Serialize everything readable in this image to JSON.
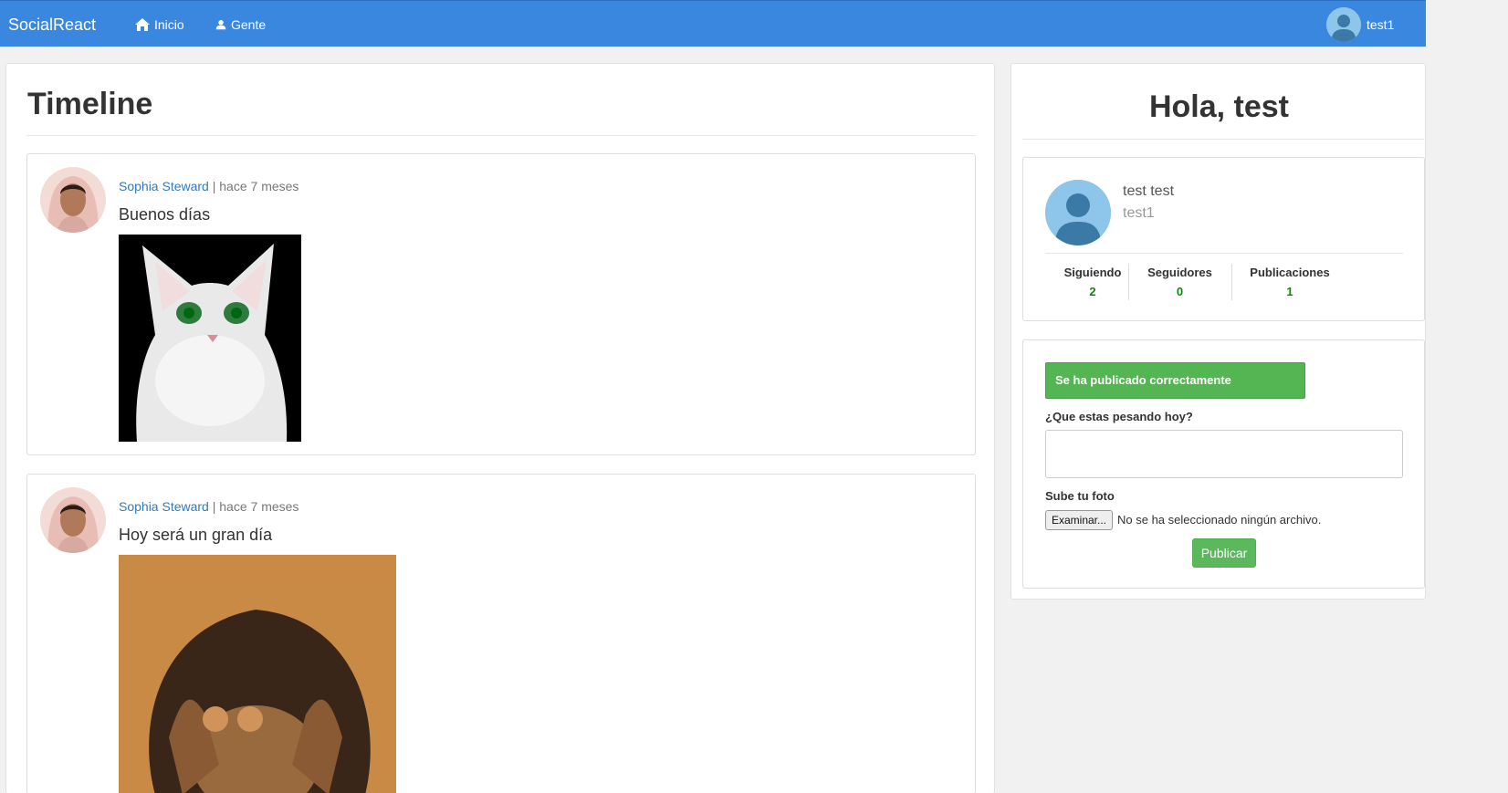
{
  "navbar": {
    "brand": "SocialReact",
    "home_label": "Inicio",
    "people_label": "Gente",
    "username": "test1",
    "home_icon": "home-icon",
    "people_icon": "user-icon"
  },
  "timeline": {
    "title": "Timeline",
    "posts": [
      {
        "author": "Sophia Steward",
        "separator": " | ",
        "time": "hace 7 meses",
        "text": "Buenos días"
      },
      {
        "author": "Sophia Steward",
        "separator": " | ",
        "time": "hace 7 meses",
        "text": "Hoy será un gran día"
      }
    ]
  },
  "sidebar": {
    "greeting": "Hola, test",
    "profile": {
      "name": "test test",
      "nick": "test1",
      "stats": [
        {
          "label": "Siguiendo",
          "value": "2"
        },
        {
          "label": "Seguidores",
          "value": "0"
        },
        {
          "label": "Publicaciones",
          "value": "1"
        }
      ]
    },
    "form": {
      "alert": "Se ha publicado correctamente",
      "text_label": "¿Que estas pesando hoy?",
      "text_value": "",
      "photo_label": "Sube tu foto",
      "file_button": "Examinar...",
      "file_status": "No se ha seleccionado ningún archivo.",
      "submit": "Publicar"
    }
  },
  "colors": {
    "navbar": "#3a87e0",
    "link": "#337ab7",
    "success": "#5cb85c",
    "stat_value": "#0a8a0a"
  }
}
